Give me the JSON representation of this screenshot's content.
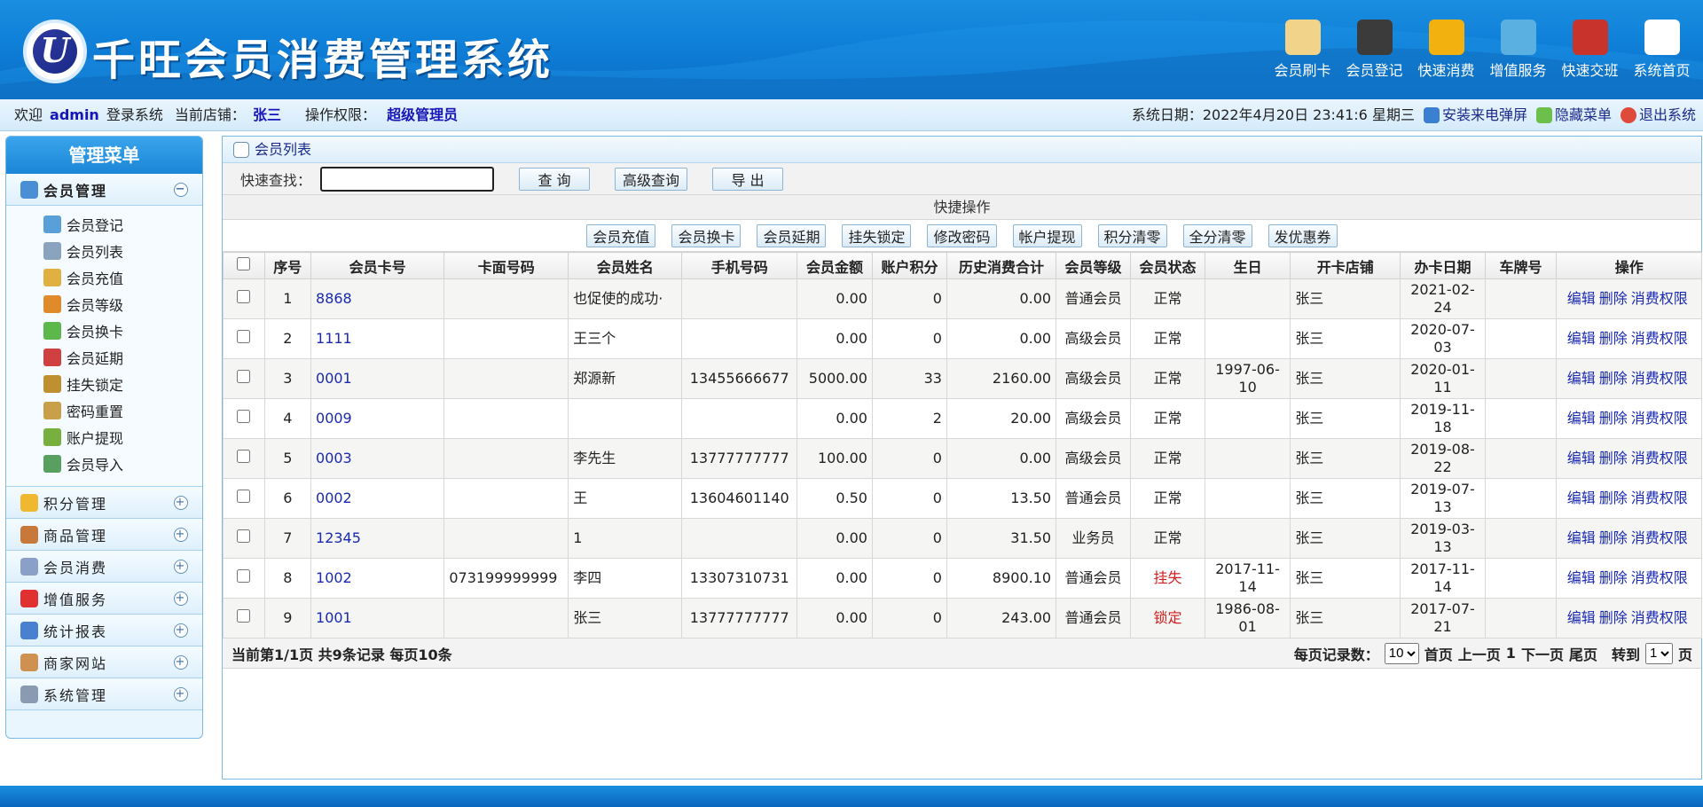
{
  "header": {
    "logo_letter": "U",
    "title": "千旺会员消费管理系统",
    "nav": [
      {
        "label": "会员刷卡",
        "icon": "card-reader-icon"
      },
      {
        "label": "会员登记",
        "icon": "user-register-icon"
      },
      {
        "label": "快速消费",
        "icon": "cart-icon"
      },
      {
        "label": "增值服务",
        "icon": "clipboard-icon"
      },
      {
        "label": "快速交班",
        "icon": "shift-handover-icon"
      },
      {
        "label": "系统首页",
        "icon": "home-icon"
      }
    ]
  },
  "status": {
    "welcome": "欢迎",
    "user": "admin",
    "login_text": "登录系统",
    "store_label": "当前店铺：",
    "store": "张三",
    "perm_label": "操作权限：",
    "perm": "超级管理员",
    "date": "系统日期：2022年4月20日 23:41:6 星期三",
    "links": [
      "安装来电弹屏",
      "隐藏菜单",
      "退出系统"
    ]
  },
  "sidebar": {
    "title": "管理菜单",
    "open_section": "会员管理",
    "items": [
      "会员登记",
      "会员列表",
      "会员充值",
      "会员等级",
      "会员换卡",
      "会员延期",
      "挂失锁定",
      "密码重置",
      "账户提现",
      "会员导入"
    ],
    "sections": [
      "积分管理",
      "商品管理",
      "会员消费",
      "增值服务",
      "统计报表",
      "商家网站",
      "系统管理"
    ]
  },
  "main": {
    "title": "会员列表",
    "search_label": "快速查找：",
    "search_value": "",
    "buttons": {
      "search": "查 询",
      "advanced": "高级查询",
      "export": "导 出"
    },
    "quick_title": "快捷操作",
    "quick_buttons": [
      "会员充值",
      "会员换卡",
      "会员延期",
      "挂失锁定",
      "修改密码",
      "帐户提现",
      "积分清零",
      "全分清零",
      "发优惠券"
    ],
    "columns": [
      "序号",
      "会员卡号",
      "卡面号码",
      "会员姓名",
      "手机号码",
      "会员金额",
      "账户积分",
      "历史消费合计",
      "会员等级",
      "会员状态",
      "生日",
      "开卡店铺",
      "办卡日期",
      "车牌号",
      "操作"
    ],
    "rows": [
      {
        "no": "1",
        "card": "8868",
        "face": "",
        "name": "也促使的成功·",
        "phone": "",
        "amount": "0.00",
        "points": "0",
        "total": "0.00",
        "level": "普通会员",
        "status": "正常",
        "birthday": "",
        "store": "张三",
        "date": "2021-02-24",
        "plate": ""
      },
      {
        "no": "2",
        "card": "1111",
        "face": "",
        "name": "王三个",
        "phone": "",
        "amount": "0.00",
        "points": "0",
        "total": "0.00",
        "level": "高级会员",
        "status": "正常",
        "birthday": "",
        "store": "张三",
        "date": "2020-07-03",
        "plate": ""
      },
      {
        "no": "3",
        "card": "0001",
        "face": "",
        "name": "郑源新",
        "phone": "13455666677",
        "amount": "5000.00",
        "points": "33",
        "total": "2160.00",
        "level": "高级会员",
        "status": "正常",
        "birthday": "1997-06-10",
        "store": "张三",
        "date": "2020-01-11",
        "plate": ""
      },
      {
        "no": "4",
        "card": "0009",
        "face": "",
        "name": "",
        "phone": "",
        "amount": "0.00",
        "points": "2",
        "total": "20.00",
        "level": "高级会员",
        "status": "正常",
        "birthday": "",
        "store": "张三",
        "date": "2019-11-18",
        "plate": ""
      },
      {
        "no": "5",
        "card": "0003",
        "face": "",
        "name": "李先生",
        "phone": "13777777777",
        "amount": "100.00",
        "points": "0",
        "total": "0.00",
        "level": "高级会员",
        "status": "正常",
        "birthday": "",
        "store": "张三",
        "date": "2019-08-22",
        "plate": ""
      },
      {
        "no": "6",
        "card": "0002",
        "face": "",
        "name": "王",
        "phone": "13604601140",
        "amount": "0.50",
        "points": "0",
        "total": "13.50",
        "level": "普通会员",
        "status": "正常",
        "birthday": "",
        "store": "张三",
        "date": "2019-07-13",
        "plate": ""
      },
      {
        "no": "7",
        "card": "12345",
        "face": "",
        "name": "1",
        "phone": "",
        "amount": "0.00",
        "points": "0",
        "total": "31.50",
        "level": "业务员",
        "status": "正常",
        "birthday": "",
        "store": "张三",
        "date": "2019-03-13",
        "plate": ""
      },
      {
        "no": "8",
        "card": "1002",
        "face": "073199999999",
        "name": "李四",
        "phone": "13307310731",
        "amount": "0.00",
        "points": "0",
        "total": "8900.10",
        "level": "普通会员",
        "status": "挂失",
        "birthday": "2017-11-14",
        "store": "张三",
        "date": "2017-11-14",
        "plate": ""
      },
      {
        "no": "9",
        "card": "1001",
        "face": "",
        "name": "张三",
        "phone": "13777777777",
        "amount": "0.00",
        "points": "0",
        "total": "243.00",
        "level": "普通会员",
        "status": "锁定",
        "birthday": "1986-08-01",
        "store": "张三",
        "date": "2017-07-21",
        "plate": ""
      }
    ],
    "ops": [
      "编辑",
      "删除",
      "消费权限"
    ],
    "pager": {
      "summary": "当前第1/1页 共9条记录 每页10条",
      "per_page_label": "每页记录数：",
      "per_page": "10",
      "first": "首页",
      "prev": "上一页",
      "current": "1",
      "next": "下一页",
      "last": "尾页",
      "goto_label": "转到",
      "goto_value": "1",
      "page_unit": "页"
    }
  },
  "colors": {
    "accent": "#0f7fd8",
    "link": "#1a2ab0",
    "alert": "#d21e1e"
  }
}
